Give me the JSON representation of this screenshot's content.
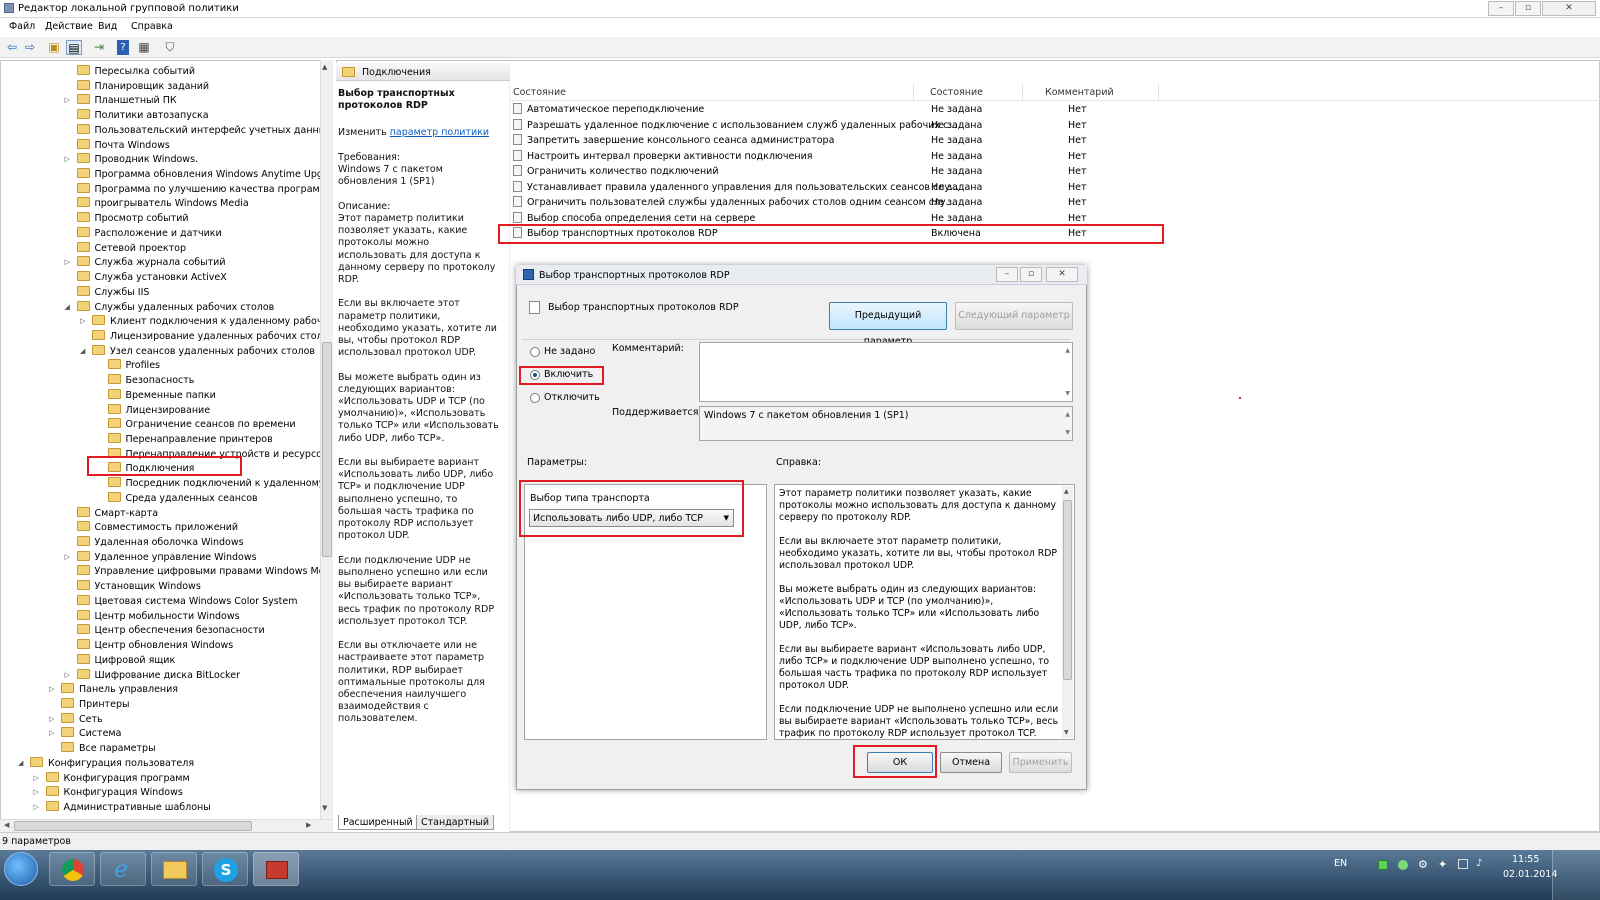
{
  "window": {
    "title": "Редактор локальной групповой политики"
  },
  "menu": [
    "Файл",
    "Действие",
    "Вид",
    "Справка"
  ],
  "tree": [
    {
      "label": "Пересылка событий",
      "indent": 3
    },
    {
      "label": "Планировщик заданий",
      "indent": 3
    },
    {
      "label": "Планшетный ПК",
      "indent": 3,
      "exp": "▷"
    },
    {
      "label": "Политики автозапуска",
      "indent": 3
    },
    {
      "label": "Пользовательский интерфейс учетных данных",
      "indent": 3
    },
    {
      "label": "Почта Windows",
      "indent": 3
    },
    {
      "label": "Проводник Windows.",
      "indent": 3,
      "exp": "▷"
    },
    {
      "label": "Программа обновления Windows Anytime Upgrade",
      "indent": 3
    },
    {
      "label": "Программа по улучшению качества программного",
      "indent": 3
    },
    {
      "label": "проигрыватель Windows Media",
      "indent": 3
    },
    {
      "label": "Просмотр событий",
      "indent": 3
    },
    {
      "label": "Расположение и датчики",
      "indent": 3
    },
    {
      "label": "Сетевой проектор",
      "indent": 3
    },
    {
      "label": "Служба журнала событий",
      "indent": 3,
      "exp": "▷"
    },
    {
      "label": "Служба установки ActiveX",
      "indent": 3
    },
    {
      "label": "Службы IIS",
      "indent": 3
    },
    {
      "label": "Службы удаленных рабочих столов",
      "indent": 3,
      "exp": "◢"
    },
    {
      "label": "Клиент подключения к удаленному рабочему с",
      "indent": 4,
      "exp": "▷"
    },
    {
      "label": "Лицензирование удаленных рабочих столов",
      "indent": 4
    },
    {
      "label": "Узел сеансов удаленных рабочих столов",
      "indent": 4,
      "exp": "◢"
    },
    {
      "label": "Profiles",
      "indent": 5
    },
    {
      "label": "Безопасность",
      "indent": 5
    },
    {
      "label": "Временные папки",
      "indent": 5
    },
    {
      "label": "Лицензирование",
      "indent": 5
    },
    {
      "label": "Ограничение сеансов по времени",
      "indent": 5
    },
    {
      "label": "Перенаправление принтеров",
      "indent": 5
    },
    {
      "label": "Перенаправление устройств и ресурсов",
      "indent": 5
    },
    {
      "label": "Подключения",
      "indent": 5,
      "selected": true
    },
    {
      "label": "Посредник подключений к удаленному раб",
      "indent": 5
    },
    {
      "label": "Среда удаленных сеансов",
      "indent": 5
    },
    {
      "label": "Смарт-карта",
      "indent": 3
    },
    {
      "label": "Совместимость приложений",
      "indent": 3
    },
    {
      "label": "Удаленная оболочка Windows",
      "indent": 3
    },
    {
      "label": "Удаленное управление Windows",
      "indent": 3,
      "exp": "▷"
    },
    {
      "label": "Управление цифровыми правами Windows Media",
      "indent": 3
    },
    {
      "label": "Установщик Windows",
      "indent": 3
    },
    {
      "label": "Цветовая система Windows Color System",
      "indent": 3
    },
    {
      "label": "Центр мобильности Windows",
      "indent": 3
    },
    {
      "label": "Центр обеспечения безопасности",
      "indent": 3
    },
    {
      "label": "Центр обновления Windows",
      "indent": 3
    },
    {
      "label": "Цифровой ящик",
      "indent": 3
    },
    {
      "label": "Шифрование диска BitLocker",
      "indent": 3,
      "exp": "▷"
    },
    {
      "label": "Панель управления",
      "indent": 2,
      "exp": "▷"
    },
    {
      "label": "Принтеры",
      "indent": 2
    },
    {
      "label": "Сеть",
      "indent": 2,
      "exp": "▷"
    },
    {
      "label": "Система",
      "indent": 2,
      "exp": "▷"
    },
    {
      "label": "Все параметры",
      "indent": 2
    },
    {
      "label": "Конфигурация пользователя",
      "indent": 0,
      "exp": "◢"
    },
    {
      "label": "Конфигурация программ",
      "indent": 1,
      "exp": "▷"
    },
    {
      "label": "Конфигурация Windows",
      "indent": 1,
      "exp": "▷"
    },
    {
      "label": "Административные шаблоны",
      "indent": 1,
      "exp": "▷"
    }
  ],
  "right": {
    "header": "Подключения",
    "desc_title": "Выбор транспортных протоколов RDP",
    "edit_prefix": "Изменить",
    "edit_link": "параметр политики",
    "desc_body": "Требования:\nWindows 7 с пакетом обновления 1 (SP1)\n\nОписание:\nЭтот параметр политики позволяет указать, какие протоколы можно использовать для доступа к данному серверу по протоколу RDP.\n\nЕсли вы включаете этот параметр политики, необходимо указать, хотите ли вы, чтобы протокол RDP использовал протокол UDP.\n\nВы можете выбрать один из следующих вариантов: «Использовать UDP и TCP (по умолчанию)», «Использовать только TCP» или «Использовать либо UDP, либо TCP».\n\nЕсли вы выбираете вариант «Использовать либо UDP, либо TCP» и подключение UDP выполнено успешно, то большая часть трафика по протоколу RDP использует протокол UDP.\n\nЕсли подключение UDP не выполнено успешно или если вы выбираете вариант «Использовать только TCP», весь трафик по протоколу RDP использует протокол TCP.\n\nЕсли вы отключаете или не настраиваете этот параметр политики, RDP выбирает оптимальные протоколы для обеспечения наилучшего взаимодействия с пользователем.",
    "columns": [
      "Состояние",
      "Состояние",
      "Комментарий"
    ],
    "policies": [
      {
        "name": "Автоматическое переподключение",
        "state": "Не задана",
        "comment": "Нет"
      },
      {
        "name": "Разрешать удаленное подключение с использованием служб удаленных рабочих с...",
        "state": "Не задана",
        "comment": "Нет"
      },
      {
        "name": "Запретить завершение консольного сеанса администратора",
        "state": "Не задана",
        "comment": "Нет"
      },
      {
        "name": "Настроить интервал проверки активности подключения",
        "state": "Не задана",
        "comment": "Нет"
      },
      {
        "name": "Ограничить количество подключений",
        "state": "Не задана",
        "comment": "Нет"
      },
      {
        "name": "Устанавливает правила удаленного управления для пользовательских сеансов слу...",
        "state": "Не задана",
        "comment": "Нет"
      },
      {
        "name": "Ограничить пользователей службы удаленных рабочих столов одним сеансом слу...",
        "state": "Не задана",
        "comment": "Нет"
      },
      {
        "name": "Выбор способа определения сети на сервере",
        "state": "Не задана",
        "comment": "Нет"
      },
      {
        "name": "Выбор транспортных протоколов RDP",
        "state": "Включена",
        "comment": "Нет"
      }
    ],
    "tabs": [
      "Расширенный",
      "Стандартный"
    ]
  },
  "dialog": {
    "title": "Выбор транспортных протоколов RDP",
    "policy_name": "Выбор транспортных протоколов RDP",
    "prev": "Предыдущий параметр",
    "next": "Следующий параметр",
    "radios": [
      "Не задано",
      "Включить",
      "Отключить"
    ],
    "comment_label": "Комментарий:",
    "supported_label": "Поддерживается:",
    "supported_value": "Windows 7 с пакетом обновления 1 (SP1)",
    "params_label": "Параметры:",
    "help_label": "Справка:",
    "transport_label": "Выбор типа транспорта",
    "transport_value": "Использовать либо UDP, либо TCP",
    "help_text": "Этот параметр политики позволяет указать, какие протоколы можно использовать для доступа к данному серверу по протоколу RDP.\n\nЕсли вы включаете этот параметр политики, необходимо указать, хотите ли вы, чтобы протокол RDP использовал протокол UDP.\n\nВы можете выбрать один из следующих вариантов: «Использовать UDP и TCP (по умолчанию)», «Использовать только TCP» или «Использовать либо UDP, либо TCP».\n\nЕсли вы выбираете вариант «Использовать либо UDP, либо TCP» и подключение UDP выполнено успешно, то большая часть трафика по протоколу RDP использует протокол UDP.\n\nЕсли подключение UDP не выполнено успешно или если вы выбираете вариант «Использовать только TCP», весь трафик по протоколу RDP использует протокол TCP.",
    "ok": "ОК",
    "cancel": "Отмена",
    "apply": "Применить"
  },
  "status": "9 параметров",
  "taskbar": {
    "lang": "EN",
    "time": "11:55",
    "date": "02.01.2014"
  }
}
